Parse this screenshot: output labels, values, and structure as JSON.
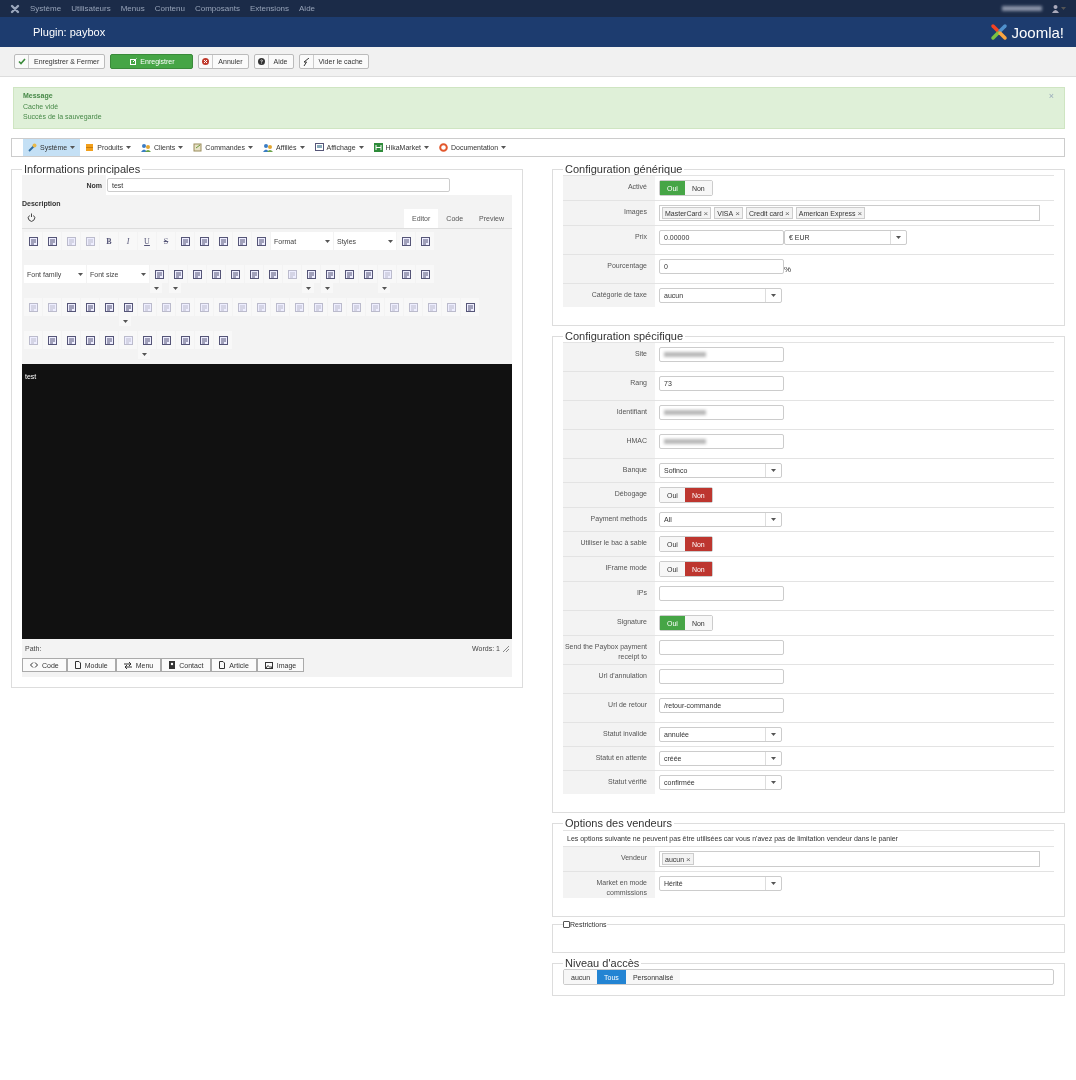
{
  "topbar": {
    "menu": [
      "Système",
      "Utilisateurs",
      "Menus",
      "Contenu",
      "Composants",
      "Extensions",
      "Aide"
    ],
    "username_redacted": true
  },
  "header": {
    "title": "Plugin: paybox",
    "logo": "Joomla!"
  },
  "toolbar": [
    {
      "label": "Enregistrer & Fermer",
      "kind": "save-close"
    },
    {
      "label": "Enregistrer",
      "kind": "save"
    },
    {
      "label": "Annuler",
      "kind": "cancel"
    },
    {
      "label": "Aide",
      "kind": "help"
    },
    {
      "label": "Vider le cache",
      "kind": "clear"
    }
  ],
  "message": {
    "title": "Message",
    "lines": [
      "Cache vidé",
      "Succès de la sauvegarde"
    ],
    "close": "×"
  },
  "menubar": [
    {
      "label": "Système",
      "kind": "tools",
      "selected": true
    },
    {
      "label": "Produits",
      "kind": "box",
      "selected": false
    },
    {
      "label": "Clients",
      "kind": "users",
      "selected": false
    },
    {
      "label": "Commandes",
      "kind": "cart",
      "selected": false
    },
    {
      "label": "Affiliés",
      "kind": "users",
      "selected": false
    },
    {
      "label": "Affichage",
      "kind": "screen",
      "selected": false
    },
    {
      "label": "HikaMarket",
      "kind": "market",
      "selected": false
    },
    {
      "label": "Documentation",
      "kind": "ring",
      "selected": false
    }
  ],
  "main": {
    "legend": "Informations principales",
    "name_label": "Nom",
    "name_value": "test",
    "description_label": "Description",
    "editor_tabs": [
      {
        "label": "Editor",
        "selected": true
      },
      {
        "label": "Code",
        "selected": false
      },
      {
        "label": "Preview",
        "selected": false
      }
    ],
    "toolbar_rows": [
      [
        {
          "kind": "icon",
          "disabled": false
        },
        {
          "kind": "icon",
          "disabled": false
        },
        {
          "kind": "icon",
          "disabled": true
        },
        {
          "kind": "icon",
          "disabled": true
        },
        {
          "kind": "bold",
          "text": "B"
        },
        {
          "kind": "italic",
          "text": "I"
        },
        {
          "kind": "underline",
          "text": "U"
        },
        {
          "kind": "strike",
          "text": "S"
        },
        {
          "kind": "icon",
          "disabled": false
        },
        {
          "kind": "icon",
          "disabled": false
        },
        {
          "kind": "icon",
          "disabled": false
        },
        {
          "kind": "icon",
          "disabled": false
        },
        {
          "kind": "icon",
          "disabled": false
        },
        {
          "kind": "select",
          "value": "Format"
        },
        {
          "kind": "select",
          "value": "Styles"
        },
        {
          "kind": "icon",
          "disabled": false
        },
        {
          "kind": "icon",
          "disabled": false
        }
      ],
      [
        {
          "kind": "select",
          "value": "Font family"
        },
        {
          "kind": "select",
          "value": "Font size"
        },
        {
          "kind": "split",
          "disabled": false
        },
        {
          "kind": "split",
          "disabled": false
        },
        {
          "kind": "icon",
          "disabled": false
        },
        {
          "kind": "icon",
          "disabled": false
        },
        {
          "kind": "icon",
          "disabled": false
        },
        {
          "kind": "icon",
          "disabled": false
        },
        {
          "kind": "icon",
          "disabled": false
        },
        {
          "kind": "icon",
          "disabled": true
        },
        {
          "kind": "split",
          "disabled": false
        },
        {
          "kind": "split",
          "disabled": false
        },
        {
          "kind": "icon",
          "disabled": false
        },
        {
          "kind": "icon",
          "disabled": false
        },
        {
          "kind": "split",
          "disabled": true
        },
        {
          "kind": "icon",
          "disabled": false
        },
        {
          "kind": "icon",
          "disabled": false
        }
      ],
      [
        {
          "kind": "icon",
          "disabled": true
        },
        {
          "kind": "icon",
          "disabled": true
        },
        {
          "kind": "icon",
          "disabled": false
        },
        {
          "kind": "icon",
          "disabled": false
        },
        {
          "kind": "icon",
          "disabled": false
        },
        {
          "kind": "split",
          "disabled": false
        },
        {
          "kind": "icon",
          "disabled": true
        },
        {
          "kind": "icon",
          "disabled": true
        },
        {
          "kind": "icon",
          "disabled": true
        },
        {
          "kind": "icon",
          "disabled": true
        },
        {
          "kind": "icon",
          "disabled": true
        },
        {
          "kind": "icon",
          "disabled": true
        },
        {
          "kind": "icon",
          "disabled": true
        },
        {
          "kind": "icon",
          "disabled": true
        },
        {
          "kind": "icon",
          "disabled": true
        },
        {
          "kind": "icon",
          "disabled": true
        },
        {
          "kind": "icon",
          "disabled": true
        },
        {
          "kind": "icon",
          "disabled": true
        },
        {
          "kind": "icon",
          "disabled": true
        },
        {
          "kind": "icon",
          "disabled": true
        },
        {
          "kind": "icon",
          "disabled": true
        },
        {
          "kind": "icon",
          "disabled": true
        },
        {
          "kind": "icon",
          "disabled": true
        },
        {
          "kind": "icon",
          "disabled": false
        }
      ],
      [
        {
          "kind": "icon",
          "disabled": true
        },
        {
          "kind": "icon",
          "disabled": false
        },
        {
          "kind": "icon",
          "disabled": false
        },
        {
          "kind": "icon",
          "disabled": false
        },
        {
          "kind": "icon",
          "disabled": false
        },
        {
          "kind": "icon",
          "disabled": true
        },
        {
          "kind": "split",
          "disabled": false
        },
        {
          "kind": "icon",
          "disabled": false
        },
        {
          "kind": "icon",
          "disabled": false
        },
        {
          "kind": "icon",
          "disabled": false
        },
        {
          "kind": "icon",
          "disabled": false
        }
      ]
    ],
    "content": "test",
    "path_label": "Path:",
    "word_count": "Words: 1",
    "buttons": [
      {
        "label": "Code",
        "kind": "code"
      },
      {
        "label": "Module",
        "kind": "doc"
      },
      {
        "label": "Menu",
        "kind": "arrows"
      },
      {
        "label": "Contact",
        "kind": "card"
      },
      {
        "label": "Article",
        "kind": "doc"
      },
      {
        "label": "Image",
        "kind": "picture"
      }
    ]
  },
  "generic": {
    "legend": "Configuration générique",
    "rows": [
      {
        "label": "Activé",
        "kind": "toggle",
        "options": [
          {
            "label": "Oui",
            "selected": true
          },
          {
            "label": "Non",
            "selected": false
          }
        ]
      },
      {
        "label": "Images",
        "kind": "tags",
        "tags": [
          {
            "label": "MasterCard",
            "remove": "×"
          },
          {
            "label": "VISA",
            "remove": "×"
          },
          {
            "label": "Credit card",
            "remove": "×"
          },
          {
            "label": "American Express",
            "remove": "×"
          }
        ]
      },
      {
        "label": "Prix",
        "kind": "price",
        "value": "0.00000",
        "currency": "€ EUR"
      },
      {
        "label": "Pourcentage",
        "kind": "text",
        "value": "0",
        "suffix": "%"
      },
      {
        "label": "Catégorie de taxe",
        "kind": "select",
        "value": "aucun"
      }
    ]
  },
  "specific": {
    "legend": "Configuration spécifique",
    "rows": [
      {
        "label": "Site",
        "kind": "text",
        "redacted": true
      },
      {
        "label": "Rang",
        "kind": "text",
        "value": "73"
      },
      {
        "label": "Identifiant",
        "kind": "text",
        "redacted": true
      },
      {
        "label": "HMAC",
        "kind": "text",
        "redacted": true
      },
      {
        "label": "Banque",
        "kind": "select",
        "value": "Sofinco"
      },
      {
        "label": "Débogage",
        "kind": "toggle",
        "options": [
          {
            "label": "Oui",
            "selected": false
          },
          {
            "label": "Non",
            "selected": true
          }
        ]
      },
      {
        "label": "Payment methods",
        "kind": "select",
        "value": "All"
      },
      {
        "label": "Utiliser le bac à sable",
        "kind": "toggle",
        "options": [
          {
            "label": "Oui",
            "selected": false
          },
          {
            "label": "Non",
            "selected": true
          }
        ]
      },
      {
        "label": "IFrame mode",
        "kind": "toggle",
        "options": [
          {
            "label": "Oui",
            "selected": false
          },
          {
            "label": "Non",
            "selected": true
          }
        ]
      },
      {
        "label": "IPs",
        "kind": "text"
      },
      {
        "label": "Signature",
        "kind": "toggle",
        "options": [
          {
            "label": "Oui",
            "selected": true
          },
          {
            "label": "Non",
            "selected": false
          }
        ]
      },
      {
        "label": "Send the Paybox payment receipt to",
        "kind": "text"
      },
      {
        "label": "Url d'annulation",
        "kind": "text"
      },
      {
        "label": "Url de retour",
        "kind": "text",
        "value": "/retour-commande"
      },
      {
        "label": "Statut invalide",
        "kind": "select",
        "value": "annulée"
      },
      {
        "label": "Statut en attente",
        "kind": "select",
        "value": "créée"
      },
      {
        "label": "Statut vérifié",
        "kind": "select",
        "value": "confirmée"
      }
    ]
  },
  "vendors": {
    "legend": "Options des vendeurs",
    "note": "Les options suivante ne peuvent pas être utilisées car vous n'avez pas de limitation vendeur dans le panier",
    "rows": [
      {
        "label": "Vendeur",
        "kind": "tags",
        "tags": [
          {
            "label": "aucun",
            "remove": "×"
          }
        ]
      },
      {
        "label": "Market en mode commissions",
        "kind": "select",
        "value": "Hérité"
      }
    ]
  },
  "restrictions": {
    "legend": "Restrictions",
    "checked": false
  },
  "access": {
    "legend": "Niveau d'accès",
    "options": [
      {
        "label": "aucun",
        "selected": false
      },
      {
        "label": "Tous",
        "selected": true
      },
      {
        "label": "Personnalisé",
        "selected": false
      }
    ]
  }
}
